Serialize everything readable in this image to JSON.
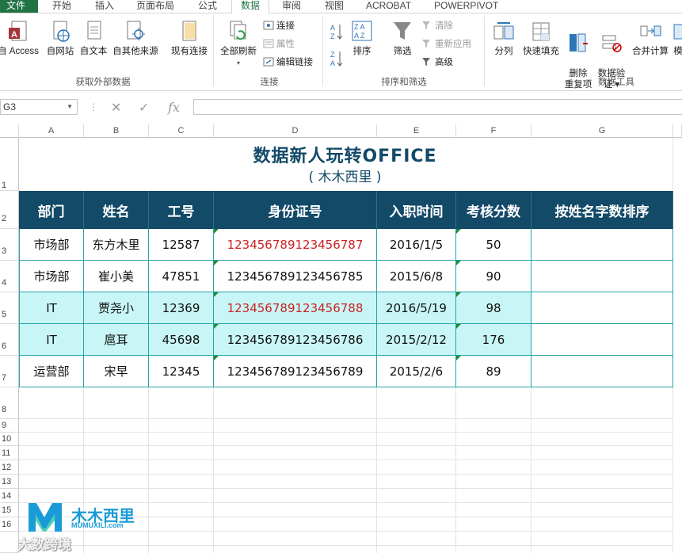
{
  "tabs": [
    "文件",
    "开始",
    "插入",
    "页面布局",
    "公式",
    "数据",
    "审阅",
    "视图",
    "ACROBAT",
    "POWERPIVOT"
  ],
  "ribbon": {
    "get_external": {
      "buttons": [
        "自 Access",
        "自网站",
        "自文本",
        "自其他来源",
        "现有连接"
      ],
      "group_label": "获取外部数据"
    },
    "connections": {
      "refresh_all": "全部刷新",
      "small": [
        "连接",
        "属性",
        "编辑链接"
      ],
      "group_label": "连接"
    },
    "sort_filter": {
      "sort": "排序",
      "filter": "筛选",
      "small": [
        "清除",
        "重新应用",
        "高级"
      ],
      "group_label": "排序和筛选"
    },
    "data_tools": {
      "buttons": [
        "分列",
        "快速填充",
        "删除\n重复项",
        "数据验\n证 ▾",
        "合并计算",
        "模"
      ],
      "group_label": "数据工具"
    }
  },
  "formula_bar": {
    "name_box": "G3",
    "formula": ""
  },
  "columns": [
    "A",
    "B",
    "C",
    "D",
    "E",
    "F",
    "G"
  ],
  "rows": [
    "1",
    "2",
    "3",
    "4",
    "5",
    "6",
    "7",
    "8",
    "9",
    "10",
    "11",
    "12",
    "13",
    "14",
    "15",
    "16"
  ],
  "sheet": {
    "title": "数据新人玩转OFFICE",
    "subtitle": "( 木木西里 )",
    "headers": [
      "部门",
      "姓名",
      "工号",
      "身份证号",
      "入职时间",
      "考核分数",
      "按姓名字数排序"
    ],
    "data": [
      [
        "市场部",
        "东方木里",
        "12587",
        "123456789123456787",
        "2016/1/5",
        "50"
      ],
      [
        "市场部",
        "崔小美",
        "47851",
        "123456789123456785",
        "2015/6/8",
        "90"
      ],
      [
        "IT",
        "贾尧小",
        "12369",
        "123456789123456788",
        "2016/5/19",
        "98"
      ],
      [
        "IT",
        "扈耳",
        "45698",
        "123456789123456786",
        "2015/2/12",
        "176"
      ],
      [
        "运营部",
        "宋早",
        "12345",
        "123456789123456789",
        "2015/2/6",
        "89"
      ]
    ]
  },
  "watermark": {
    "brand": "木木西里",
    "url": "MUMUXILI.com",
    "overlay": "大数跨境"
  },
  "colors": {
    "excel_green": "#217346",
    "header_fill": "#124a68",
    "highlight": "#c8f6f6",
    "border": "#27a3a8",
    "red_text": "#cc2222"
  }
}
